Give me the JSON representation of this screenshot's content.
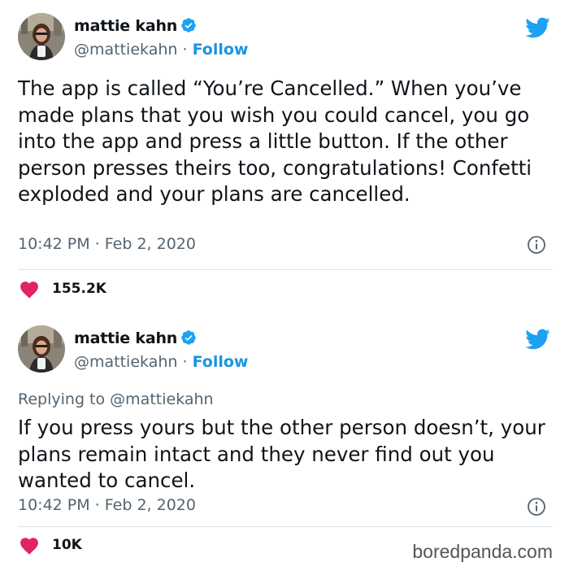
{
  "tweets": [
    {
      "author": {
        "name": "mattie kahn",
        "handle": "@mattiekahn",
        "separator": "·",
        "follow_label": "Follow",
        "verified": true
      },
      "text": "The app is called “You’re Cancelled.” When you’ve made plans that you wish you could cancel, you go into the app and press a little button. If the other person presses theirs too, congratulations! Confetti exploded and your plans are cancelled.",
      "timestamp": "10:42 PM · Feb 2, 2020",
      "likes": "155.2K"
    },
    {
      "author": {
        "name": "mattie kahn",
        "handle": "@mattiekahn",
        "separator": "·",
        "follow_label": "Follow",
        "verified": true
      },
      "replying_to_label": "Replying to",
      "replying_to_handle": "@mattiekahn",
      "text": "If you press yours but the other person doesn’t, your plans remain intact and they never find out you wanted to cancel.",
      "timestamp": "10:42 PM · Feb 2, 2020",
      "likes": "10K"
    }
  ],
  "icons": {
    "brand": "twitter-bird-icon",
    "verified": "verified-badge-icon",
    "info": "info-icon",
    "like": "heart-icon"
  },
  "colors": {
    "brand_blue": "#1da1f2",
    "follow_blue": "#1b95e0",
    "verified_blue": "#1da1f2",
    "heart_pink": "#e0245e",
    "muted": "#536471"
  },
  "watermark": "boredpanda.com"
}
